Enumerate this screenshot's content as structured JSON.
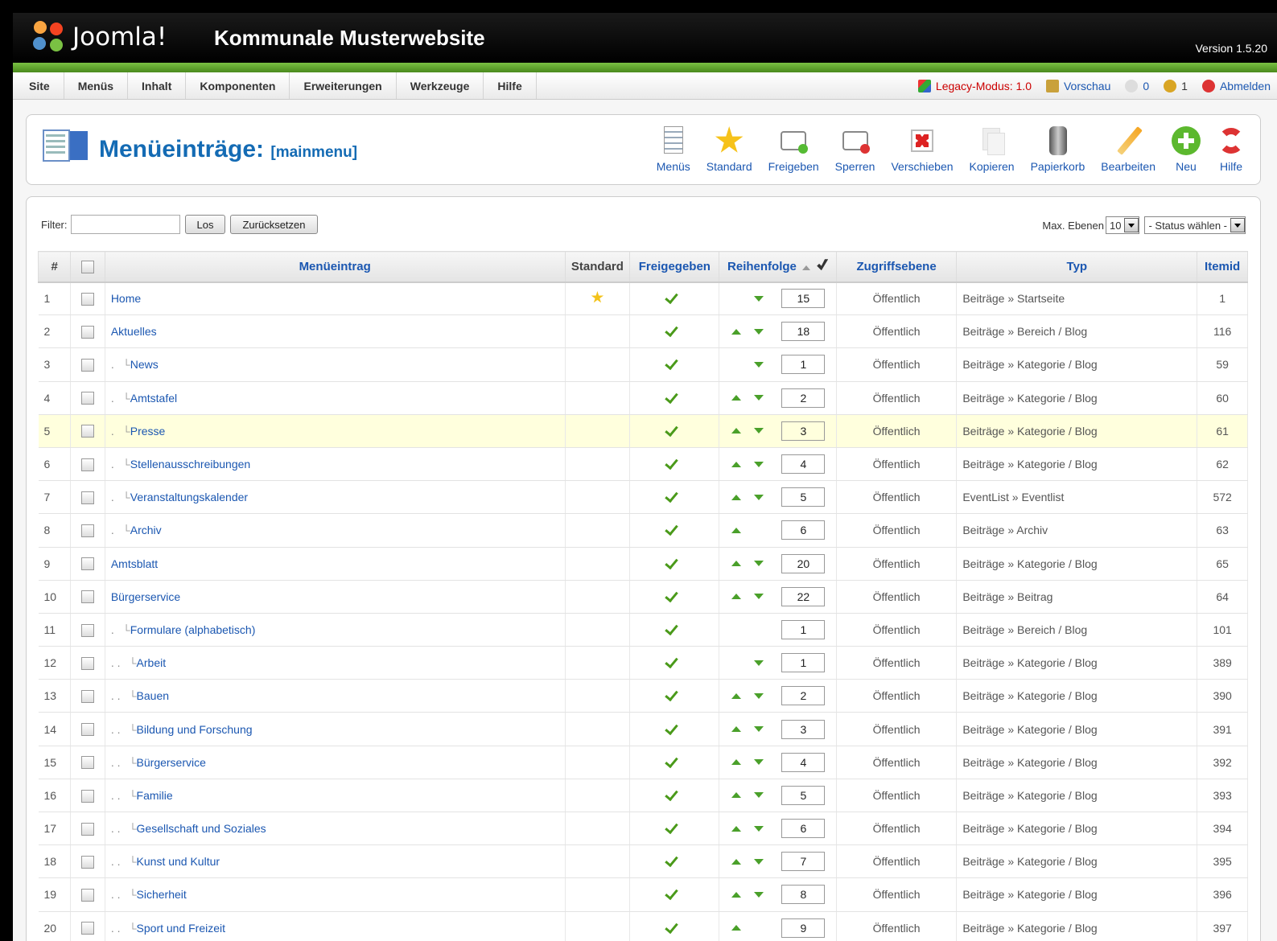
{
  "header": {
    "logo_text": "Joomla!",
    "site_title": "Kommunale Musterwebsite",
    "version": "Version 1.5.20"
  },
  "menu": [
    "Site",
    "Menüs",
    "Inhalt",
    "Komponenten",
    "Erweiterungen",
    "Werkzeuge",
    "Hilfe"
  ],
  "status": {
    "legacy": "Legacy-Modus: 1.0",
    "preview": "Vorschau",
    "messages": "0",
    "users": "1",
    "logout": "Abmelden"
  },
  "page": {
    "title": "Menüeinträge:",
    "subtitle": "[mainmenu]"
  },
  "toolbar": [
    "Menüs",
    "Standard",
    "Freigeben",
    "Sperren",
    "Verschieben",
    "Kopieren",
    "Papierkorb",
    "Bearbeiten",
    "Neu",
    "Hilfe"
  ],
  "filter": {
    "label": "Filter:",
    "value": "",
    "go": "Los",
    "reset": "Zurücksetzen",
    "levels_label": "Max. Ebenen",
    "levels_value": "10",
    "status_value": "- Status wählen -"
  },
  "table": {
    "headers": {
      "num": "#",
      "name": "Menüeintrag",
      "standard": "Standard",
      "published": "Freigegeben",
      "order": "Reihenfolge",
      "access": "Zugriffsebene",
      "type": "Typ",
      "itemid": "Itemid"
    },
    "rows": [
      {
        "num": "1",
        "indent": "",
        "name": "Home",
        "default": true,
        "up": false,
        "down": true,
        "order": "15",
        "access": "Öffentlich",
        "type": "Beiträge » Startseite",
        "itemid": "1"
      },
      {
        "num": "2",
        "indent": "",
        "name": "Aktuelles",
        "default": false,
        "up": true,
        "down": true,
        "order": "18",
        "access": "Öffentlich",
        "type": "Beiträge » Bereich / Blog",
        "itemid": "116"
      },
      {
        "num": "3",
        "indent": ".",
        "name": "News",
        "default": false,
        "up": false,
        "down": true,
        "order": "1",
        "access": "Öffentlich",
        "type": "Beiträge » Kategorie / Blog",
        "itemid": "59"
      },
      {
        "num": "4",
        "indent": ".",
        "name": "Amtstafel",
        "default": false,
        "up": true,
        "down": true,
        "order": "2",
        "access": "Öffentlich",
        "type": "Beiträge » Kategorie / Blog",
        "itemid": "60"
      },
      {
        "num": "5",
        "indent": ".",
        "name": "Presse",
        "default": false,
        "up": true,
        "down": true,
        "order": "3",
        "access": "Öffentlich",
        "type": "Beiträge » Kategorie / Blog",
        "itemid": "61",
        "highlight": true
      },
      {
        "num": "6",
        "indent": ".",
        "name": "Stellenausschreibungen",
        "default": false,
        "up": true,
        "down": true,
        "order": "4",
        "access": "Öffentlich",
        "type": "Beiträge » Kategorie / Blog",
        "itemid": "62"
      },
      {
        "num": "7",
        "indent": ".",
        "name": "Veranstaltungskalender",
        "default": false,
        "up": true,
        "down": true,
        "order": "5",
        "access": "Öffentlich",
        "type": "EventList » Eventlist",
        "itemid": "572"
      },
      {
        "num": "8",
        "indent": ".",
        "name": "Archiv",
        "default": false,
        "up": true,
        "down": false,
        "order": "6",
        "access": "Öffentlich",
        "type": "Beiträge » Archiv",
        "itemid": "63"
      },
      {
        "num": "9",
        "indent": "",
        "name": "Amtsblatt",
        "default": false,
        "up": true,
        "down": true,
        "order": "20",
        "access": "Öffentlich",
        "type": "Beiträge » Kategorie / Blog",
        "itemid": "65"
      },
      {
        "num": "10",
        "indent": "",
        "name": "Bürgerservice",
        "default": false,
        "up": true,
        "down": true,
        "order": "22",
        "access": "Öffentlich",
        "type": "Beiträge » Beitrag",
        "itemid": "64"
      },
      {
        "num": "11",
        "indent": ".",
        "name": "Formulare (alphabetisch)",
        "default": false,
        "up": false,
        "down": false,
        "order": "1",
        "access": "Öffentlich",
        "type": "Beiträge » Bereich / Blog",
        "itemid": "101"
      },
      {
        "num": "12",
        "indent": ".  .",
        "name": "Arbeit",
        "default": false,
        "up": false,
        "down": true,
        "order": "1",
        "access": "Öffentlich",
        "type": "Beiträge » Kategorie / Blog",
        "itemid": "389"
      },
      {
        "num": "13",
        "indent": ".  .",
        "name": "Bauen",
        "default": false,
        "up": true,
        "down": true,
        "order": "2",
        "access": "Öffentlich",
        "type": "Beiträge » Kategorie / Blog",
        "itemid": "390"
      },
      {
        "num": "14",
        "indent": ".  .",
        "name": "Bildung und Forschung",
        "default": false,
        "up": true,
        "down": true,
        "order": "3",
        "access": "Öffentlich",
        "type": "Beiträge » Kategorie / Blog",
        "itemid": "391"
      },
      {
        "num": "15",
        "indent": ".  .",
        "name": "Bürgerservice",
        "default": false,
        "up": true,
        "down": true,
        "order": "4",
        "access": "Öffentlich",
        "type": "Beiträge » Kategorie / Blog",
        "itemid": "392"
      },
      {
        "num": "16",
        "indent": ".  .",
        "name": "Familie",
        "default": false,
        "up": true,
        "down": true,
        "order": "5",
        "access": "Öffentlich",
        "type": "Beiträge » Kategorie / Blog",
        "itemid": "393"
      },
      {
        "num": "17",
        "indent": ".  .",
        "name": "Gesellschaft und Soziales",
        "default": false,
        "up": true,
        "down": true,
        "order": "6",
        "access": "Öffentlich",
        "type": "Beiträge » Kategorie / Blog",
        "itemid": "394"
      },
      {
        "num": "18",
        "indent": ".  .",
        "name": "Kunst und Kultur",
        "default": false,
        "up": true,
        "down": true,
        "order": "7",
        "access": "Öffentlich",
        "type": "Beiträge » Kategorie / Blog",
        "itemid": "395"
      },
      {
        "num": "19",
        "indent": ".  .",
        "name": "Sicherheit",
        "default": false,
        "up": true,
        "down": true,
        "order": "8",
        "access": "Öffentlich",
        "type": "Beiträge » Kategorie / Blog",
        "itemid": "396"
      },
      {
        "num": "20",
        "indent": ".  .",
        "name": "Sport und Freizeit",
        "default": false,
        "up": true,
        "down": false,
        "order": "9",
        "access": "Öffentlich",
        "type": "Beiträge » Kategorie / Blog",
        "itemid": "397"
      }
    ]
  }
}
